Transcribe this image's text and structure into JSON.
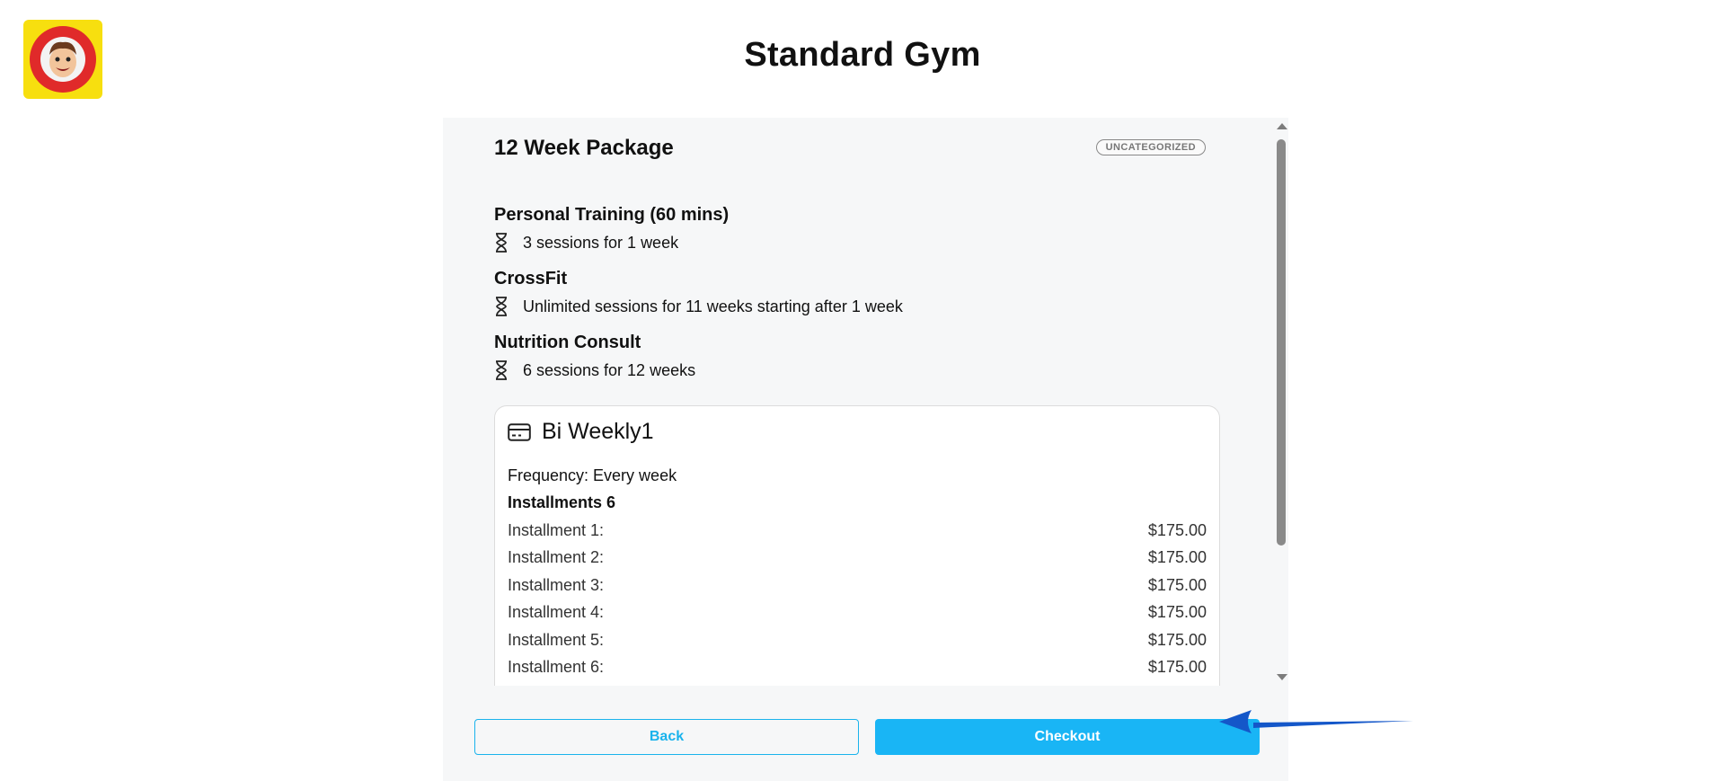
{
  "header": {
    "title": "Standard Gym"
  },
  "package": {
    "title": "12 Week Package",
    "badge": "UNCATEGORIZED",
    "services": [
      {
        "name": "Personal Training (60 mins)",
        "detail": "3 sessions for 1 week"
      },
      {
        "name": "CrossFit",
        "detail": "Unlimited sessions for 11 weeks starting after 1 week"
      },
      {
        "name": "Nutrition Consult",
        "detail": "6 sessions for 12 weeks"
      }
    ]
  },
  "plan": {
    "title": "Bi Weekly1",
    "frequency": "Frequency: Every week",
    "installments_heading": "Installments 6",
    "installments": [
      {
        "label": "Installment 1:",
        "amount": "$175.00"
      },
      {
        "label": "Installment 2:",
        "amount": "$175.00"
      },
      {
        "label": "Installment 3:",
        "amount": "$175.00"
      },
      {
        "label": "Installment 4:",
        "amount": "$175.00"
      },
      {
        "label": "Installment 5:",
        "amount": "$175.00"
      },
      {
        "label": "Installment 6:",
        "amount": "$175.00"
      }
    ]
  },
  "actions": {
    "back_label": "Back",
    "checkout_label": "Checkout"
  },
  "colors": {
    "accent": "#19b5f5",
    "annotation_arrow": "#1457c9",
    "logo_background": "#f7df0f"
  },
  "icons": {
    "logo": "mascot-logo",
    "service": "hourglass-icon",
    "plan": "credit-card-icon",
    "annotation": "arrow-left-icon"
  }
}
